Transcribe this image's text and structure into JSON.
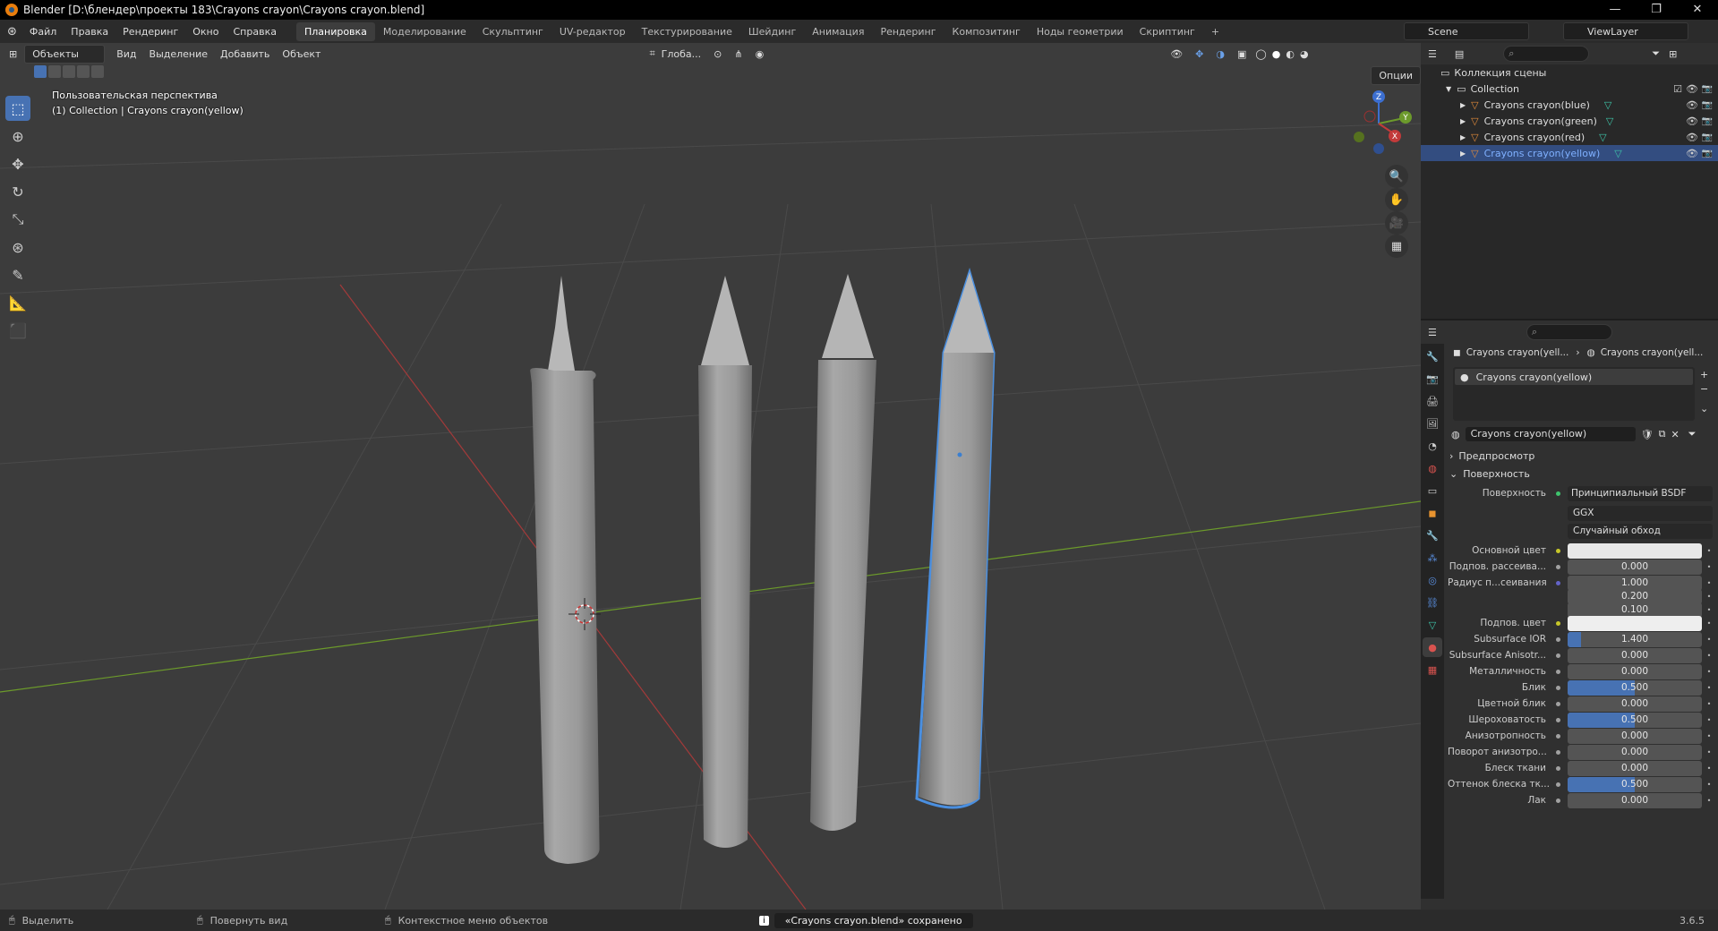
{
  "title": "Blender [D:\\блендер\\проекты 183\\Crayons crayon\\Crayons crayon.blend]",
  "window_buttons": [
    "—",
    "❐",
    "✕"
  ],
  "menu": [
    "Файл",
    "Правка",
    "Рендеринг",
    "Окно",
    "Справка"
  ],
  "workspaces": [
    "Планировка",
    "Моделирование",
    "Скульптинг",
    "UV-редактор",
    "Текстурирование",
    "Шейдинг",
    "Анимация",
    "Рендеринг",
    "Композитинг",
    "Ноды геометрии",
    "Скриптинг"
  ],
  "workspace_add": "+",
  "scene_name": "Scene",
  "view_layer": "ViewLayer",
  "viewport": {
    "mode": "Объекты",
    "menus": [
      "Вид",
      "Выделение",
      "Добавить",
      "Объект"
    ],
    "transform": "Глоба...",
    "options": "Опции",
    "info_line1": "Пользовательская перспектива",
    "info_line2": "(1) Collection | Crayons crayon(yellow)",
    "gizmo_axes": [
      "Z",
      "Y",
      "X"
    ]
  },
  "outliner": {
    "scene_collection": "Коллекция сцены",
    "collection": "Collection",
    "items": [
      "Crayons crayon(blue)",
      "Crayons crayon(green)",
      "Crayons crayon(red)",
      "Crayons crayon(yellow)"
    ],
    "selected": "Crayons crayon(yellow)"
  },
  "properties": {
    "breadcrumb_object": "Crayons crayon(yell...",
    "breadcrumb_material": "Crayons crayon(yell...",
    "slot": "Crayons crayon(yellow)",
    "material_name": "Crayons crayon(yellow)",
    "panel_preview": "Предпросмотр",
    "panel_surface": "Поверхность",
    "surface_label": "Поверхность",
    "surface_value": "Принципиальный BSDF",
    "distribution": "GGX",
    "subsurface_method": "Случайный обход",
    "rows": [
      {
        "label": "Основной цвет",
        "type": "color",
        "color": "#e8e8e8"
      },
      {
        "label": "Подпов. рассеива...",
        "value": "0.000",
        "frac": 0
      },
      {
        "label": "Радиус п...сеивания",
        "value": "1.000",
        "frac": 0,
        "dot": "purple"
      },
      {
        "label": "",
        "value": "0.200",
        "frac": 0
      },
      {
        "label": "",
        "value": "0.100",
        "frac": 0
      },
      {
        "label": "Подпов. цвет",
        "type": "color",
        "color": "#eeeeee"
      },
      {
        "label": "Subsurface IOR",
        "value": "1.400",
        "frac": 0.1
      },
      {
        "label": "Subsurface Anisotr...",
        "value": "0.000",
        "frac": 0
      },
      {
        "label": "Металличность",
        "value": "0.000",
        "frac": 0
      },
      {
        "label": "Блик",
        "value": "0.500",
        "frac": 0.5
      },
      {
        "label": "Цветной блик",
        "value": "0.000",
        "frac": 0
      },
      {
        "label": "Шероховатость",
        "value": "0.500",
        "frac": 0.5
      },
      {
        "label": "Анизотропность",
        "value": "0.000",
        "frac": 0
      },
      {
        "label": "Поворот анизотро...",
        "value": "0.000",
        "frac": 0
      },
      {
        "label": "Блеск ткани",
        "value": "0.000",
        "frac": 0
      },
      {
        "label": "Оттенок блеска тк...",
        "value": "0.500",
        "frac": 0.5
      },
      {
        "label": "Лак",
        "value": "0.000",
        "frac": 0
      }
    ]
  },
  "status": {
    "select": "Выделить",
    "rotate": "Повернуть вид",
    "context": "Контекстное меню объектов",
    "message": "«Crayons crayon.blend» сохранено",
    "version": "3.6.5"
  },
  "colors": {
    "accent": "#4772b3",
    "selected_outline": "#4a8fe0",
    "axis_x": "#c23a3a",
    "axis_y": "#6c9a2b"
  }
}
